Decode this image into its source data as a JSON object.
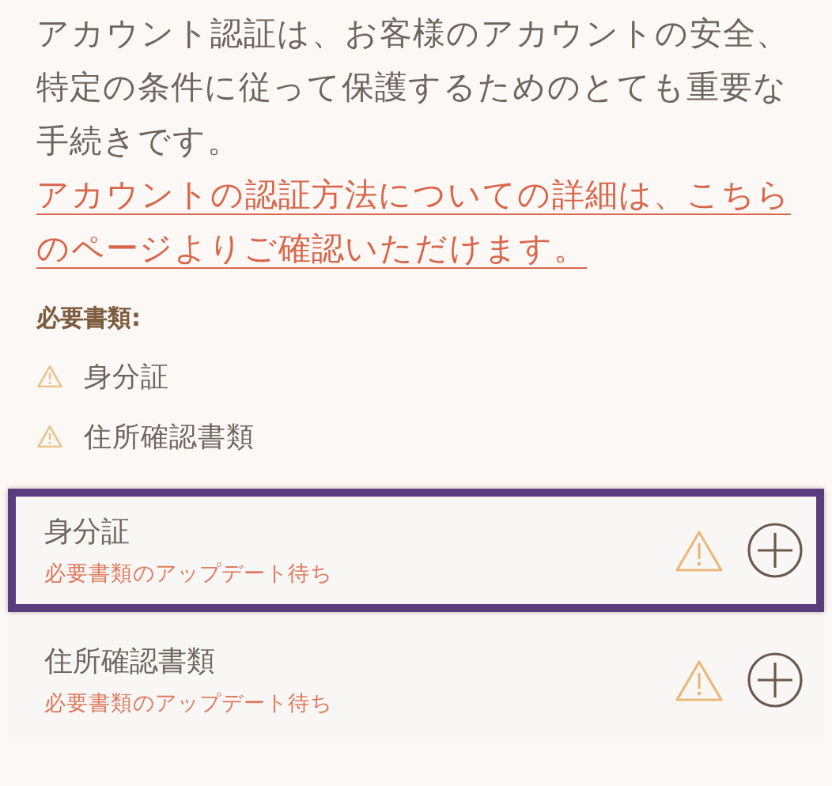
{
  "intro": {
    "text": "アカウント認証は、お客様のアカウントの安全、特定の条件に従って保護するためのとても重要な手続きです。",
    "link": "アカウントの認証方法についての詳細は、こちらのページよりご確認いただけます。"
  },
  "required": {
    "heading": "必要書類:",
    "items": [
      "身分証",
      "住所確認書類"
    ]
  },
  "documents": [
    {
      "title": "身分証",
      "status": "必要書類のアップデート待ち",
      "selected": true
    },
    {
      "title": "住所確認書類",
      "status": "必要書類のアップデート待ち",
      "selected": false
    }
  ]
}
